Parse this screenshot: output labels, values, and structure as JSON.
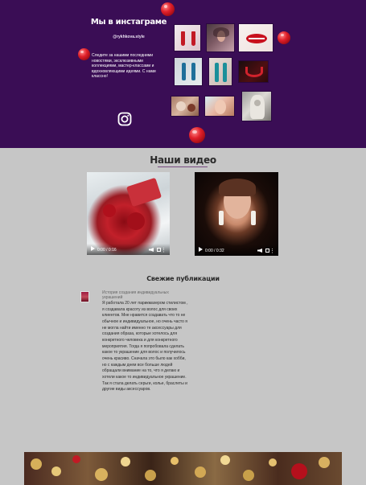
{
  "instagram": {
    "title": "Мы в инстаграме",
    "handle": "@rykhkova.style",
    "description": "Следите за нашими последними новостями, эксклюзивными коллекциями, мастер-классами и вдохновляющими идеями. С нами классно!",
    "icon": "instagram-icon"
  },
  "videos": {
    "title": "Наши видео",
    "items": [
      {
        "time": "0:00 / 0:16"
      },
      {
        "time": "0:00 / 0:32"
      }
    ]
  },
  "posts": {
    "title": "Свежие публикации",
    "items": [
      {
        "heading": "История создания индивидуальных украшений",
        "body": "Я работала 20 лет парикмахером стилистом , я создавала красоту из волос для своих клиентов. Мне нравится создавать что то не обычное и индивидуальное, но очень часто я не могла найти именно те аксессуары для создания образа, которые хотелось для конкретного человека и для конкретного мероприятия. Тогда я попробовала сделать какое то украшение для волос и получилось очень красиво. Сначала это было как хобби, но с каждым днем все больше людей обращали внимание на то, что я делаю и хотели какое то индивидуальное украшение. Так я стала делать серьги, колье, браслеты и другие виды аксессуаров."
      }
    ]
  },
  "colors": {
    "instagram_band": "#3a0d55",
    "page_background": "#c6c6c6",
    "accent_red": "#e0202a"
  }
}
